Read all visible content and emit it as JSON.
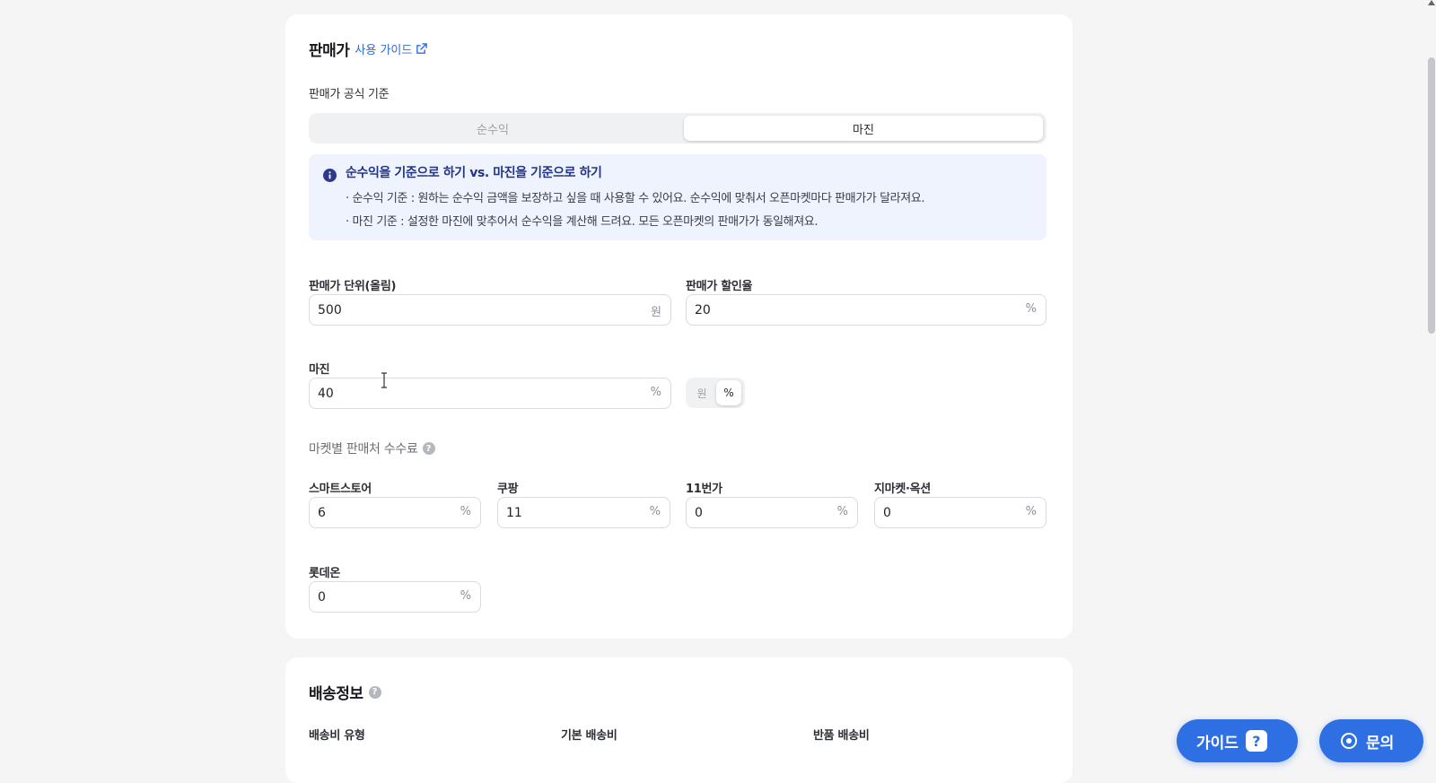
{
  "pricing": {
    "title": "판매가",
    "guide_link": "사용 가이드",
    "formula_label": "판매가 공식 기준",
    "formula_options": [
      "순수익",
      "마진"
    ],
    "formula_selected": "마진",
    "info": {
      "title": "순수익을 기준으로 하기 vs. 마진을 기준으로 하기",
      "line1": "· 순수익 기준 : 원하는 순수익 금액을 보장하고 싶을 때 사용할 수 있어요. 순수익에 맞춰서 오픈마켓마다 판매가가 달라져요.",
      "line2": "· 마진 기준 : 설정한 마진에 맞추어서 순수익을 계산해 드려요. 모든 오픈마켓의 판매가가 동일해져요."
    },
    "unit_label": "판매가 단위(올림)",
    "unit_value": "500",
    "unit_suffix": "원",
    "discount_label": "판매가 할인율",
    "discount_value": "20",
    "discount_suffix": "%",
    "margin_label": "마진",
    "margin_value": "40",
    "margin_suffix": "%",
    "margin_toggle": [
      "원",
      "%"
    ],
    "margin_toggle_selected": "%",
    "fee_section_label": "마켓별 판매처 수수료",
    "fees": [
      {
        "label": "스마트스토어",
        "value": "6",
        "suffix": "%"
      },
      {
        "label": "쿠팡",
        "value": "11",
        "suffix": "%"
      },
      {
        "label": "11번가",
        "value": "0",
        "suffix": "%"
      },
      {
        "label": "지마켓·옥션",
        "value": "0",
        "suffix": "%"
      },
      {
        "label": "롯데온",
        "value": "0",
        "suffix": "%"
      }
    ]
  },
  "shipping": {
    "title": "배송정보",
    "columns": [
      "배송비 유형",
      "기본 배송비",
      "반품 배송비"
    ]
  },
  "floating": {
    "guide_label": "가이드",
    "inquiry_label": "문의"
  },
  "colors": {
    "accent": "#2f6fe4",
    "info_bg": "#eef3fd",
    "info_title": "#22348a"
  }
}
